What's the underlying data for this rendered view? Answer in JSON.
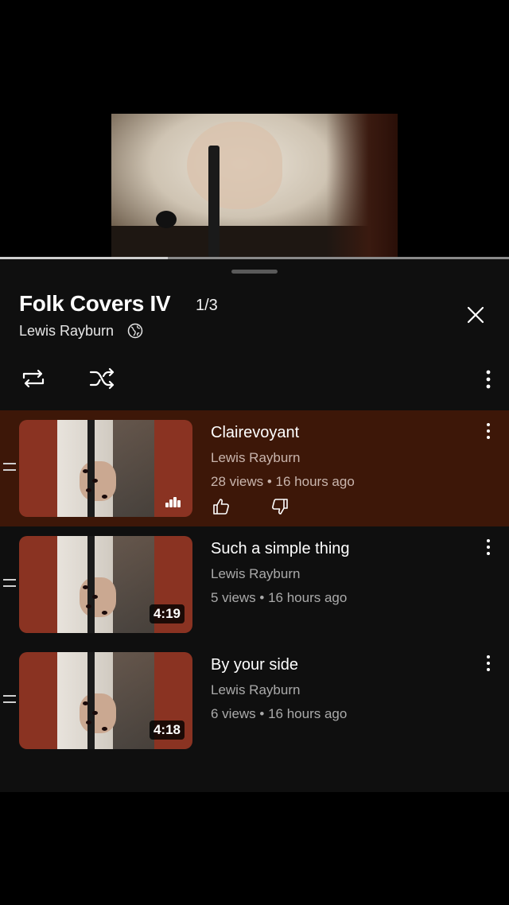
{
  "player": {
    "progress": 0.33
  },
  "playlist": {
    "title": "Folk Covers IV",
    "position": "1/3",
    "owner": "Lewis Rayburn"
  },
  "videos": [
    {
      "title": "Clairevoyant",
      "channel": "Lewis Rayburn",
      "meta": "28 views • 16 hours ago",
      "duration": "",
      "now_playing": true
    },
    {
      "title": "Such a simple thing",
      "channel": "Lewis Rayburn",
      "meta": "5 views • 16 hours ago",
      "duration": "4:19",
      "now_playing": false
    },
    {
      "title": "By your side",
      "channel": "Lewis Rayburn",
      "meta": "6 views • 16 hours ago",
      "duration": "4:18",
      "now_playing": false
    }
  ],
  "icons": {
    "globe": "globe-icon",
    "close": "close-icon",
    "loop": "loop-icon",
    "shuffle": "shuffle-icon",
    "more": "more-vertical-icon",
    "like": "thumbs-up-icon",
    "dislike": "thumbs-down-icon",
    "drag": "drag-handle-icon",
    "now_playing": "equalizer-icon"
  },
  "colors": {
    "panel": "#0f0f0f",
    "active_row": "#3d1708",
    "thumb_bg": "#8a3322",
    "secondary_text": "#aaaaaa"
  }
}
